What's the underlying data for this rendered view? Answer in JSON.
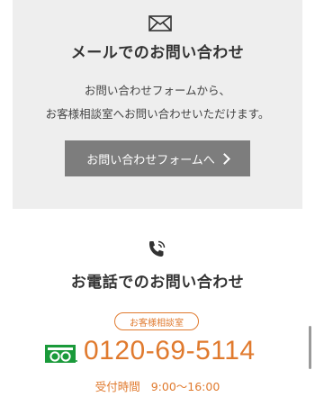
{
  "mail": {
    "icon": "envelope-icon",
    "title": "メールでのお問い合わせ",
    "desc_line1": "お問い合わせフォームから、",
    "desc_line2": "お客様相談室へお問い合わせいただけます。",
    "button_label": "お問い合わせフォームへ",
    "button_icon": "chevron-right-icon"
  },
  "phone": {
    "icon": "phone-icon",
    "title": "お電話でのお問い合わせ",
    "badge": "お客様相談室",
    "freedial_icon": "free-dial-icon",
    "number": "0120-69-5114",
    "hours_label": "受付時間",
    "hours_value": "9:00〜16:00"
  },
  "colors": {
    "accent": "#e07a2e",
    "freedial_green": "#1a9a3a",
    "panel_bg": "#eeeeee",
    "button_bg": "#7d7d7d"
  }
}
